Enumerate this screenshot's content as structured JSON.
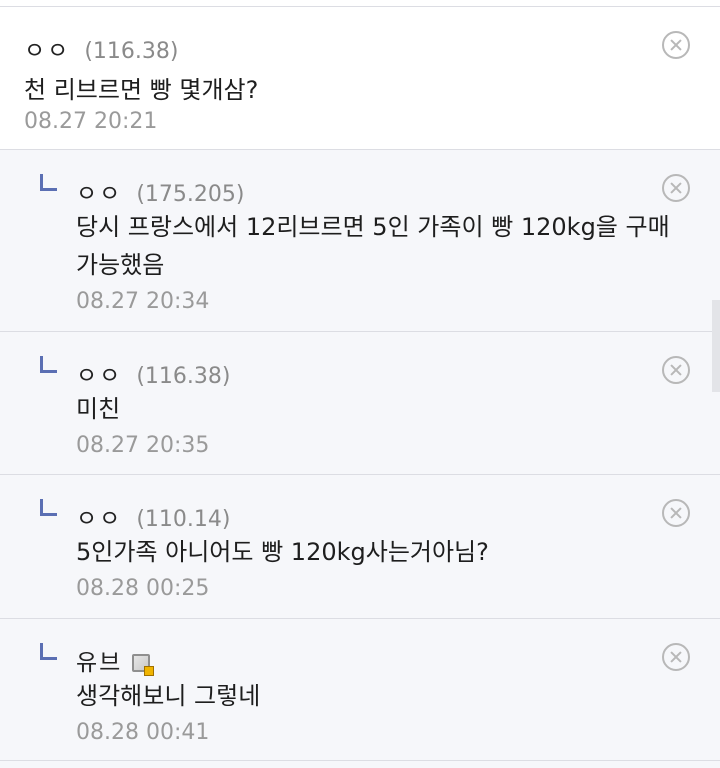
{
  "comments": [
    {
      "nick": "ㅇㅇ",
      "ip": "(116.38)",
      "text": "천 리브르면 빵 몇개삼?",
      "date": "08.27 20:21",
      "has_icon": false
    },
    {
      "nick": "ㅇㅇ",
      "ip": "(175.205)",
      "text": "당시 프랑스에서 12리브르면 5인 가족이 빵 120kg을 구매 가능했음",
      "date": "08.27 20:34",
      "has_icon": false
    },
    {
      "nick": "ㅇㅇ",
      "ip": "(116.38)",
      "text": "미친",
      "date": "08.27 20:35",
      "has_icon": false
    },
    {
      "nick": "ㅇㅇ",
      "ip": "(110.14)",
      "text": "5인가족 아니어도 빵 120kg사는거아님?",
      "date": "08.28 00:25",
      "has_icon": false
    },
    {
      "nick": "유브",
      "ip": "",
      "text": "생각해보니 그렇네",
      "date": "08.28 00:41",
      "has_icon": true
    }
  ],
  "icons": {
    "delete": "delete-circle-x-icon",
    "reply": "reply-arrow-icon",
    "member": "gallery-member-icon"
  },
  "colors": {
    "reply_bg": "#f6f7fa",
    "reply_mark": "#5b6fb3",
    "meta_gray": "#9a9a9a"
  }
}
